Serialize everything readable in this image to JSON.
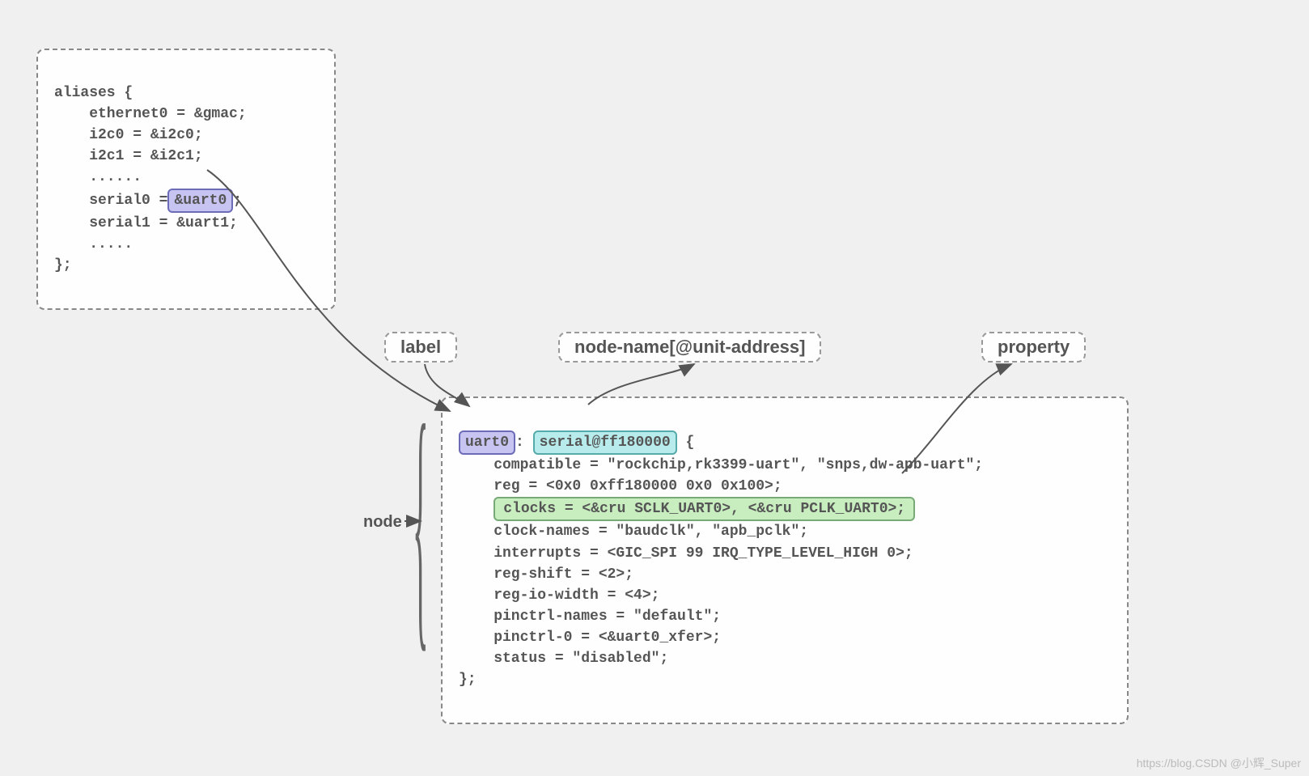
{
  "aliases_box": {
    "open": "aliases {",
    "l1": "    ethernet0 = &gmac;",
    "l2": "    i2c0 = &i2c0;",
    "l3": "    i2c1 = &i2c1;",
    "l4": "    ......",
    "l5_pre": "    serial0 =",
    "l5_hl": "&uart0",
    "l5_post": ";",
    "l6": "    serial1 = &uart1;",
    "l7": "    .....",
    "close": "};"
  },
  "labels": {
    "label": "label",
    "nodename": "node-name[@unit-address]",
    "property": "property",
    "node": "node"
  },
  "uart_box": {
    "uart0": "uart0",
    "colon": ":",
    "serialnode": "serial@ff180000",
    "brace_open": " {",
    "l1": "    compatible = \"rockchip,rk3399-uart\", \"snps,dw-apb-uart\";",
    "l2": "    reg = <0x0 0xff180000 0x0 0x100>;",
    "clocks": "clocks = <&cru SCLK_UART0>, <&cru PCLK_UART0>;",
    "l4": "    clock-names = \"baudclk\", \"apb_pclk\";",
    "l5": "    interrupts = <GIC_SPI 99 IRQ_TYPE_LEVEL_HIGH 0>;",
    "l6": "    reg-shift = <2>;",
    "l7": "    reg-io-width = <4>;",
    "l8": "    pinctrl-names = \"default\";",
    "l9": "    pinctrl-0 = <&uart0_xfer>;",
    "l10": "    status = \"disabled\";",
    "close": "};"
  },
  "watermark": "https://blog.CSDN @小辉_Super"
}
